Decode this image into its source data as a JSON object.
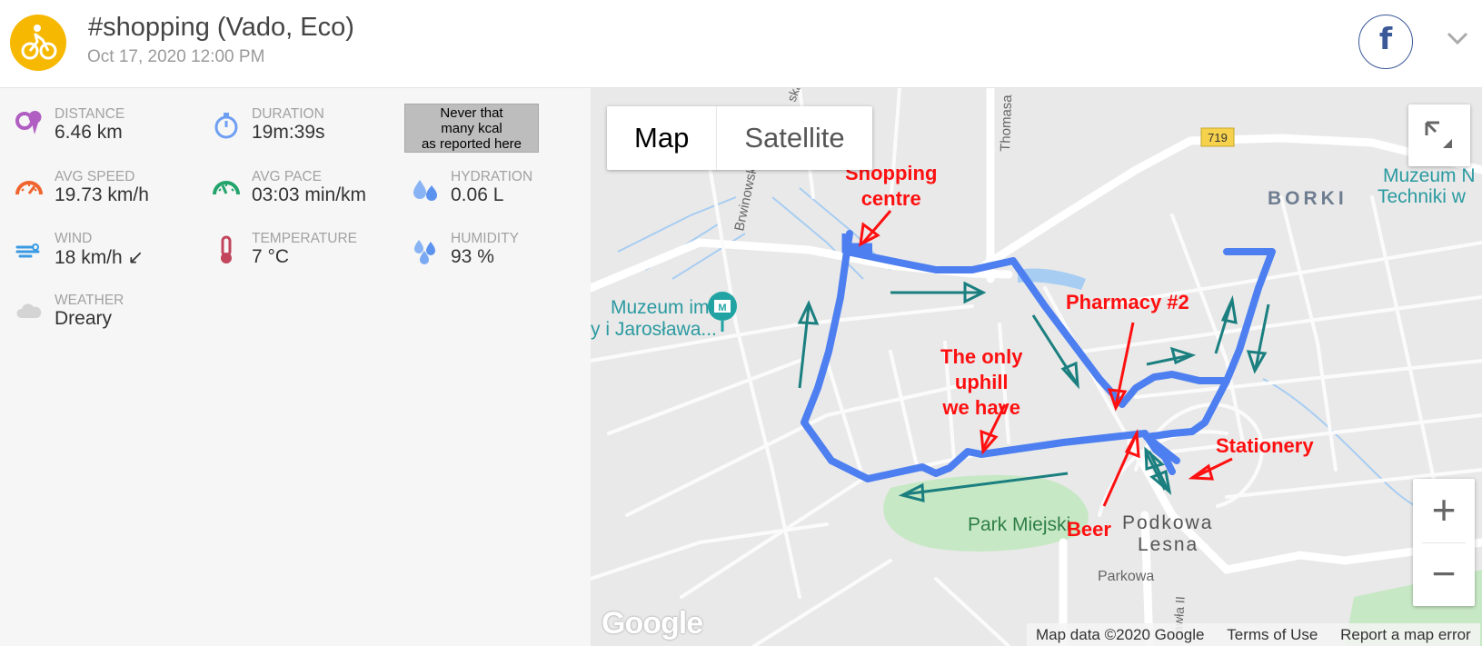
{
  "activity": {
    "title": "#shopping (Vado, Eco)",
    "date": "Oct 17, 2020 12:00 PM",
    "avatar_icon": "bicycle-icon",
    "share_icon": "facebook-icon",
    "share_label": "f",
    "menu_icon": "chevron-down-icon"
  },
  "stats": [
    {
      "icon": "distance-pin-icon",
      "label": "DISTANCE",
      "value": "6.46 km"
    },
    {
      "icon": "stopwatch-icon",
      "label": "DURATION",
      "value": "19m:39s"
    },
    {
      "icon": "speedometer-icon",
      "label": "AVG SPEED",
      "value": "19.73 km/h"
    },
    {
      "icon": "pace-gauge-icon",
      "label": "AVG PACE",
      "value": "03:03 min/km"
    },
    {
      "icon": "water-drops-icon",
      "label": "HYDRATION",
      "value": "0.06 L"
    },
    {
      "icon": "wind-icon",
      "label": "WIND",
      "value": "18 km/h ↙"
    },
    {
      "icon": "thermometer-icon",
      "label": "TEMPERATURE",
      "value": "7 °C"
    },
    {
      "icon": "humidity-drops-icon",
      "label": "HUMIDITY",
      "value": "93 %"
    },
    {
      "icon": "cloud-icon",
      "label": "WEATHER",
      "value": "Dreary"
    }
  ],
  "kcal_note": [
    "Never that",
    "many kcal",
    "as reported here"
  ],
  "map": {
    "type_buttons": {
      "map": "Map",
      "satellite": "Satellite"
    },
    "zoom_in": "+",
    "zoom_out": "−",
    "logo": "Google",
    "attribution": {
      "data": "Map data ©2020 Google",
      "terms": "Terms of Use",
      "report": "Report a map error"
    },
    "road_badge": "719",
    "labels": {
      "borki": "BORKI",
      "museum_ne_1": "Muzeum N",
      "museum_ne_2": "Techniki w",
      "museum_w_1": "Muzeum im.",
      "museum_w_2": "y i Jarosława...",
      "park": "Park Miejski",
      "town_1": "Podkowa",
      "town_2": "Lesna",
      "parkowa": "Parkowa",
      "brwinowska": "Brwinowska",
      "thomasa": "Thomasa",
      "jka": "ska",
      "pawla": "awła II"
    },
    "route_color": "#4d7ff0",
    "annotations": {
      "shopping": [
        "Shopping",
        "centre"
      ],
      "pharmacy": "Pharmacy #2",
      "uphill": [
        "The only",
        "uphill",
        "we have"
      ],
      "stationery": "Stationery",
      "beer": "Beer"
    }
  }
}
